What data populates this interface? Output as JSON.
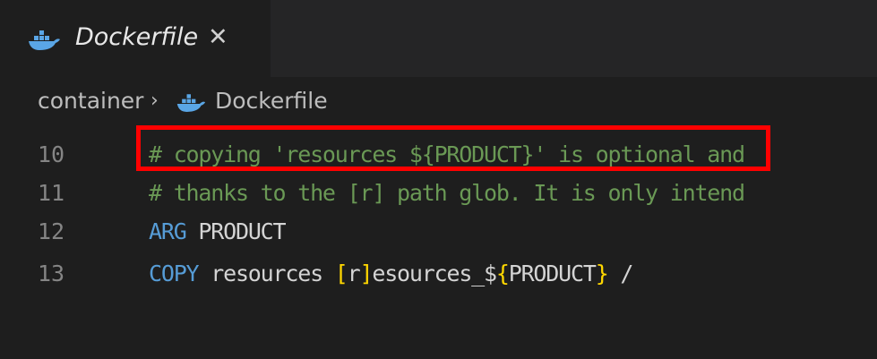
{
  "tab": {
    "label": "Dockerfile",
    "close_symbol": "✕",
    "icon": "docker-icon"
  },
  "breadcrumb": {
    "folder": "container",
    "separator": "›",
    "file": "Dockerfile",
    "file_icon": "docker-icon"
  },
  "colors": {
    "comment": "#6a9955",
    "keyword": "#569cd6",
    "text": "#d4d4d4",
    "bracket": "#ffd700",
    "line_number": "#858585",
    "highlight_border": "#ff0000",
    "docker_blue": "#5aa6e6"
  },
  "editor": {
    "lines": [
      {
        "number": "10",
        "comment": "# copying 'resources_${PRODUCT}' is optional and"
      },
      {
        "number": "11",
        "comment": "# thanks to the [r] path glob. It is only intend"
      },
      {
        "number": "12",
        "keyword": "ARG",
        "rest": " PRODUCT"
      },
      {
        "number": "13",
        "keyword": "COPY",
        "part1": " resources ",
        "bracket_open": "[",
        "part2": "r",
        "bracket_close": "]",
        "part3": "esources_$",
        "brace_open": "{",
        "part4": "PRODUCT",
        "brace_close": "}",
        "part5": " /"
      }
    ]
  }
}
